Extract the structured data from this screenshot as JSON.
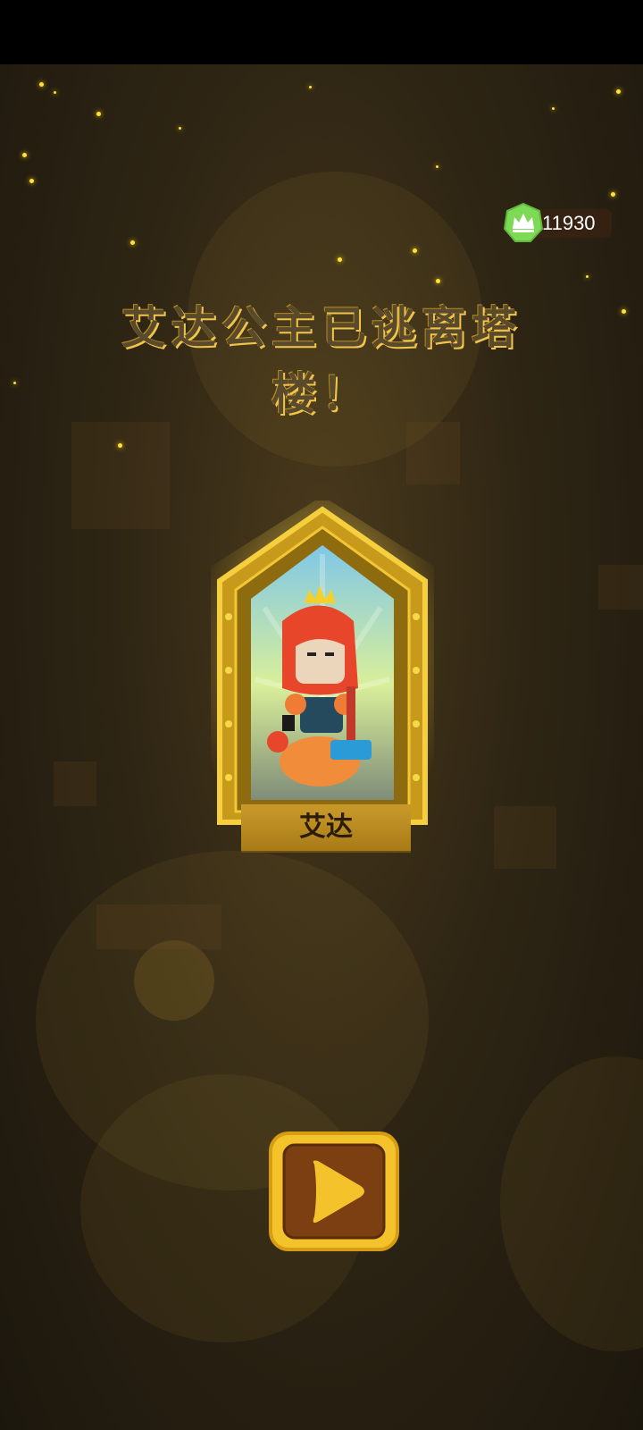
{
  "currency": {
    "icon": "crown-icon",
    "value": "11930"
  },
  "title": {
    "line1": "艾达公主已逃离塔",
    "line2": "楼！"
  },
  "character": {
    "name": "艾达",
    "portrait": "princess-with-hammer-portrait"
  },
  "actions": {
    "play_icon": "play-icon"
  },
  "colors": {
    "accent_gold": "#f4c22b",
    "crown_green": "#7ed957",
    "button_brown": "#7b3f12"
  }
}
